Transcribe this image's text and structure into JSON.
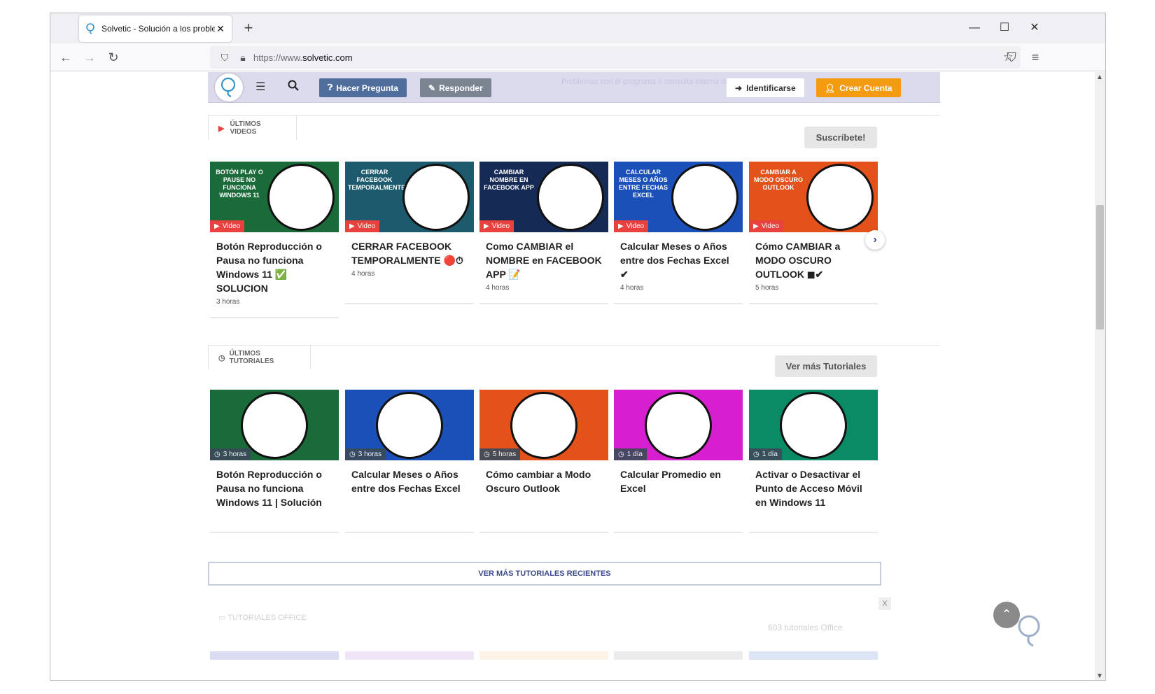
{
  "browser": {
    "tab_title": "Solvetic - Solución a los problem",
    "tab_close": "✕",
    "new_tab": "+",
    "url_prefix": "https://www.",
    "url_domain": "solvetic.com",
    "window_minimize": "—",
    "window_maximize": "☐",
    "window_close": "✕"
  },
  "header": {
    "ask_label": "Hacer Pregunta",
    "answer_label": "Responder",
    "login_label": "Identificarse",
    "signup_label": "Crear Cuenta",
    "faint_text": "Problemas con el programa o consulta interna de los"
  },
  "videos_section": {
    "tab_label": "ÚLTIMOS VIDEOS",
    "subscribe_label": "Suscríbete!",
    "items": [
      {
        "thumb_text": "BOTÓN PLAY O PAUSE NO FUNCIONA WINDOWS 11",
        "badge": "Video",
        "title": "Botón Reproducción o Pausa no funciona Windows 11 ✅ SOLUCION",
        "time": "3 horas",
        "color": "#1b6b3a"
      },
      {
        "thumb_text": "CERRAR FACEBOOK TEMPORALMENTE",
        "badge": "Video",
        "title": "CERRAR FACEBOOK TEMPORALMENTE 🔴⏱",
        "time": "4 horas",
        "color": "#1d5a6e"
      },
      {
        "thumb_text": "CAMBIAR NOMBRE EN FACEBOOK APP",
        "badge": "Video",
        "title": "Como CAMBIAR el NOMBRE en FACEBOOK APP 📝",
        "time": "4 horas",
        "color": "#162a56"
      },
      {
        "thumb_text": "CALCULAR MESES O AÑOS ENTRE FECHAS EXCEL",
        "badge": "Video",
        "title": "Calcular Meses o Años entre dos Fechas Excel ✔",
        "time": "4 horas",
        "color": "#1a50b8"
      },
      {
        "thumb_text": "CAMBIAR A MODO OSCURO OUTLOOK",
        "badge": "Video",
        "title": "Cómo CAMBIAR a MODO OSCURO OUTLOOK ◼✔",
        "time": "5 horas",
        "color": "#e2521a"
      }
    ]
  },
  "tutorials_section": {
    "tab_label": "ÚLTIMOS TUTORIALES",
    "more_label": "Ver más Tutoriales",
    "items": [
      {
        "badge": "3 horas",
        "title": "Botón Reproducción o Pausa no funciona Windows 11 | Solución",
        "color": "#1b6b3a"
      },
      {
        "badge": "3 horas",
        "title": "Calcular Meses o Años entre dos Fechas Excel",
        "color": "#1a50b8"
      },
      {
        "badge": "5 horas",
        "title": "Cómo cambiar a Modo Oscuro Outlook",
        "color": "#e2521a"
      },
      {
        "badge": "1 día",
        "title": "Calcular Promedio en Excel",
        "color": "#d61fce"
      },
      {
        "badge": "1 día",
        "title": "Activar o Desactivar el Punto de Acceso Móvil en Windows 11",
        "color": "#0b8a66"
      }
    ]
  },
  "recent_button": "VER MÁS TUTORIALES RECIENTES",
  "office_section": {
    "tab_label": "TUTORIALES OFFICE",
    "count": "603 tutoriales Office",
    "close": "X"
  }
}
